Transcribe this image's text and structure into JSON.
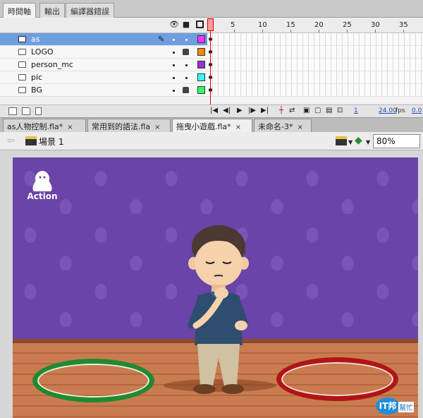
{
  "panel_tabs": [
    "時間軸",
    "輸出",
    "編譯器錯誤"
  ],
  "timeline": {
    "header_icons": [
      "eye-icon",
      "lock-icon",
      "outline-icon"
    ],
    "frame_numbers": [
      "1",
      "5",
      "10",
      "15",
      "20",
      "25",
      "30",
      "35"
    ],
    "layers": [
      {
        "name": "as",
        "selected": true,
        "color": "#ff33ff",
        "locked": false,
        "editing": true
      },
      {
        "name": "LOGO",
        "selected": false,
        "color": "#ff8800",
        "locked": true,
        "editing": false
      },
      {
        "name": "person_mc",
        "selected": false,
        "color": "#9933cc",
        "locked": false,
        "editing": false
      },
      {
        "name": "pic",
        "selected": false,
        "color": "#33ffff",
        "locked": false,
        "editing": false
      },
      {
        "name": "BG",
        "selected": false,
        "color": "#33ff66",
        "locked": true,
        "editing": false
      }
    ],
    "footer": {
      "current_frame": "1",
      "frame_rate": "24.00",
      "fps_label": "fps",
      "elapsed": "0.0"
    }
  },
  "doc_tabs": [
    {
      "label": "as人物控制.fla*",
      "active": false
    },
    {
      "label": "常用到的語法.fla",
      "active": false
    },
    {
      "label": "拖曳小遊戲.fla*",
      "active": true
    },
    {
      "label": "未命名-3*",
      "active": false
    }
  ],
  "doc_tab_close": "×",
  "edit_bar": {
    "scene_label": "場景 1",
    "zoom": "80%"
  },
  "stage": {
    "logo_text": "Action",
    "watermark_badge": "IT邦",
    "watermark_text": "幫忙"
  },
  "colors": {
    "wall": "#6a44a8",
    "floor": "#c2754a",
    "ring_left": "#1f8a2f",
    "ring_right": "#b01515"
  }
}
